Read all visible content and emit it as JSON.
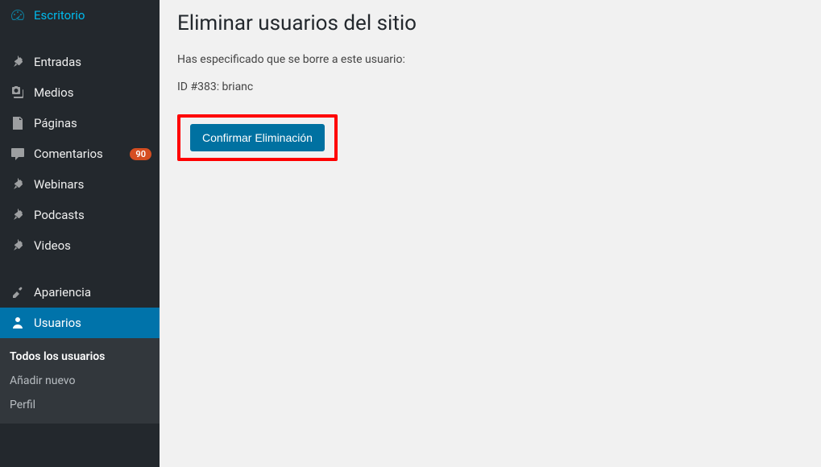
{
  "sidebar": {
    "items": [
      {
        "label": "Escritorio",
        "icon": "dashboard"
      },
      {
        "label": "Entradas",
        "icon": "pin"
      },
      {
        "label": "Medios",
        "icon": "media"
      },
      {
        "label": "Páginas",
        "icon": "page"
      },
      {
        "label": "Comentarios",
        "icon": "comment",
        "badge": "90"
      },
      {
        "label": "Webinars",
        "icon": "pin"
      },
      {
        "label": "Podcasts",
        "icon": "pin"
      },
      {
        "label": "Videos",
        "icon": "pin"
      },
      {
        "label": "Apariencia",
        "icon": "appearance"
      },
      {
        "label": "Usuarios",
        "icon": "user",
        "active": true
      }
    ],
    "submenu": [
      {
        "label": "Todos los usuarios",
        "current": true
      },
      {
        "label": "Añadir nuevo"
      },
      {
        "label": "Perfil"
      }
    ]
  },
  "main": {
    "title": "Eliminar usuarios del sitio",
    "description": "Has especificado que se borre a este usuario:",
    "user_info": "ID #383: brianc",
    "confirm_label": "Confirmar Eliminación"
  }
}
